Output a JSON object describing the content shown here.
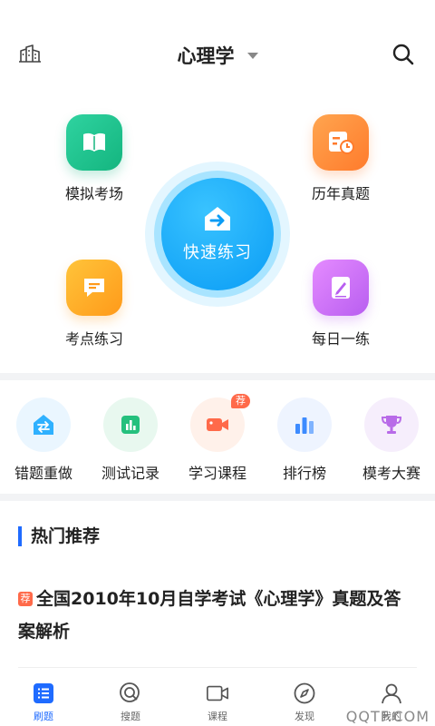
{
  "header": {
    "title": "心理学"
  },
  "features": [
    {
      "label": "模拟考场",
      "icon": "book-icon",
      "color": "#14b57f"
    },
    {
      "label": "历年真题",
      "icon": "calendar-clock-icon",
      "color": "#ff7b2c"
    },
    {
      "label": "考点练习",
      "icon": "message-note-icon",
      "color": "#ff9a1a"
    },
    {
      "label": "每日一练",
      "icon": "edit-note-icon",
      "color": "#b85ef0"
    }
  ],
  "quick_practice": {
    "label": "快速练习",
    "icon": "arrow-house-icon",
    "color": "#0a9cf5"
  },
  "tools": [
    {
      "label": "错题重做",
      "icon": "redo-icon",
      "color": "#2fb1ff"
    },
    {
      "label": "测试记录",
      "icon": "chart-record-icon",
      "color": "#24c07d"
    },
    {
      "label": "学习课程",
      "icon": "video-camera-icon",
      "color": "#ff6a4a",
      "badge": "荐"
    },
    {
      "label": "排行榜",
      "icon": "bar-rank-icon",
      "color": "#3d8bff"
    },
    {
      "label": "模考大赛",
      "icon": "trophy-icon",
      "color": "#b86be8"
    }
  ],
  "recommend": {
    "title": "热门推荐",
    "article": {
      "tag": "荐",
      "text": "全国2010年10月自学考试《心理学》真题及答案解析"
    }
  },
  "nav": [
    {
      "label": "刷题",
      "icon": "list-icon",
      "active": true
    },
    {
      "label": "搜题",
      "icon": "search-question-icon"
    },
    {
      "label": "课程",
      "icon": "video-icon"
    },
    {
      "label": "发现",
      "icon": "compass-icon"
    },
    {
      "label": "我的",
      "icon": "user-icon"
    }
  ],
  "watermark": "QQTF.COM",
  "colors": {
    "accent": "#1f6bff",
    "badge": "#ff6a4a"
  }
}
